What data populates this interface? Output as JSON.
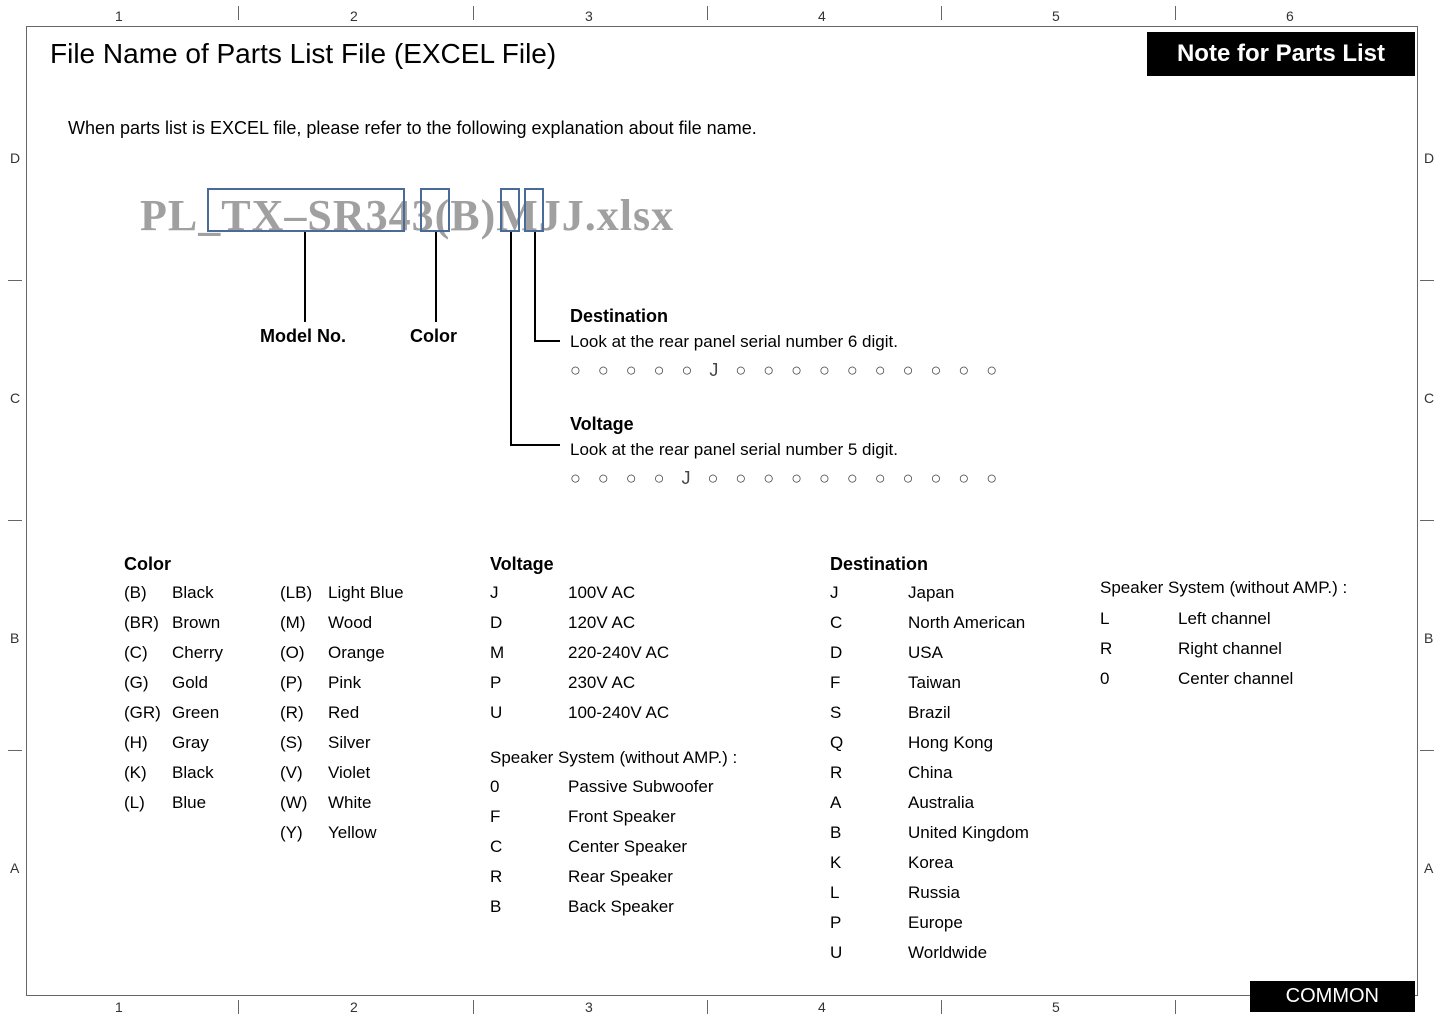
{
  "title": "File Name of Parts List File (EXCEL File)",
  "note_label": "Note for Parts List",
  "intro": "When parts list is EXCEL file, please refer to the following explanation about file name.",
  "filename_display": "PL_TX–SR343(B)MJJ.xlsx",
  "labels": {
    "model_no": "Model No.",
    "color": "Color",
    "destination": "Destination",
    "destination_desc": "Look at the rear panel serial number 6 digit.",
    "voltage": "Voltage",
    "voltage_desc": "Look at the rear panel serial number 5 digit."
  },
  "circle_row_dest": "○ ○ ○ ○ ○ J ○ ○ ○ ○ ○ ○ ○ ○ ○ ○",
  "circle_row_volt": "○ ○ ○ ○ J ○ ○ ○ ○ ○ ○ ○ ○ ○ ○ ○",
  "sections": {
    "color_head": "Color",
    "voltage_head": "Voltage",
    "destination_head": "Destination",
    "speaker_amp_head": "Speaker System (without AMP.) :"
  },
  "color_codes_left": [
    {
      "c": "(B)",
      "v": "Black"
    },
    {
      "c": "(BR)",
      "v": "Brown"
    },
    {
      "c": "(C)",
      "v": "Cherry"
    },
    {
      "c": "(G)",
      "v": "Gold"
    },
    {
      "c": "(GR)",
      "v": "Green"
    },
    {
      "c": "(H)",
      "v": "Gray"
    },
    {
      "c": "(K)",
      "v": "Black"
    },
    {
      "c": "(L)",
      "v": "Blue"
    }
  ],
  "color_codes_right": [
    {
      "c": "(LB)",
      "v": "Light Blue"
    },
    {
      "c": "(M)",
      "v": "Wood"
    },
    {
      "c": "(O)",
      "v": "Orange"
    },
    {
      "c": "(P)",
      "v": "Pink"
    },
    {
      "c": "(R)",
      "v": "Red"
    },
    {
      "c": "(S)",
      "v": "Silver"
    },
    {
      "c": "(V)",
      "v": "Violet"
    },
    {
      "c": "(W)",
      "v": "White"
    },
    {
      "c": "(Y)",
      "v": "Yellow"
    }
  ],
  "voltage_codes": [
    {
      "c": "J",
      "v": "100V AC"
    },
    {
      "c": "D",
      "v": "120V AC"
    },
    {
      "c": "M",
      "v": "220-240V AC"
    },
    {
      "c": "P",
      "v": "230V AC"
    },
    {
      "c": "U",
      "v": "100-240V AC"
    }
  ],
  "speaker_voltage": [
    {
      "c": "0",
      "v": "Passive Subwoofer"
    },
    {
      "c": "F",
      "v": "Front Speaker"
    },
    {
      "c": "C",
      "v": "Center Speaker"
    },
    {
      "c": "R",
      "v": "Rear  Speaker"
    },
    {
      "c": "B",
      "v": "Back Speaker"
    }
  ],
  "destination_codes": [
    {
      "c": "J",
      "v": "Japan"
    },
    {
      "c": "C",
      "v": "North American"
    },
    {
      "c": "D",
      "v": "USA"
    },
    {
      "c": "F",
      "v": "Taiwan"
    },
    {
      "c": "S",
      "v": "Brazil"
    },
    {
      "c": "Q",
      "v": "Hong Kong"
    },
    {
      "c": "R",
      "v": "China"
    },
    {
      "c": "A",
      "v": "Australia"
    },
    {
      "c": "B",
      "v": "United Kingdom"
    },
    {
      "c": "K",
      "v": "Korea"
    },
    {
      "c": "L",
      "v": "Russia"
    },
    {
      "c": "P",
      "v": " Europe"
    },
    {
      "c": "U",
      "v": "Worldwide"
    }
  ],
  "speaker_dest": [
    {
      "c": "L",
      "v": "Left channel"
    },
    {
      "c": "R",
      "v": "Right channel"
    },
    {
      "c": "0",
      "v": "Center channel"
    }
  ],
  "common_label": "COMMON",
  "grid": {
    "cols": [
      "1",
      "2",
      "3",
      "4",
      "5",
      "6"
    ],
    "rows": [
      "D",
      "C",
      "B",
      "A"
    ]
  }
}
